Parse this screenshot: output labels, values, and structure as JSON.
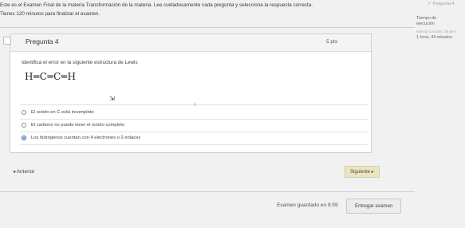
{
  "header": {
    "intro_line1": "Este es el Examen Final de la materia Transformación de la materia. Lee cuidadosamente cada pregunta y selecciona la respuesta correcta.",
    "intro_line2": "Tienes 120 minutos para finalizar el examen.",
    "nav_indicator": "Pregunta 4"
  },
  "timer": {
    "label_line1": "Tiempo de",
    "label_line2": "ejecución",
    "started": "Intento iniciado: 35 de s",
    "remaining": "1 hora, 44 minutos"
  },
  "question": {
    "title": "Pregunta 4",
    "points": "5 pts",
    "prompt": "Identifica el error en la siguiente estructura de Lewis",
    "formula": "H═C═C═H",
    "options": [
      {
        "label": "El octeto en C está incompleto",
        "selected": false
      },
      {
        "label": "El carbono no puede tener el octeto completo",
        "selected": false
      },
      {
        "label": "Los hidrógenos cuentan con 4 electrones o 2 enlaces",
        "selected": true
      }
    ]
  },
  "navigation": {
    "prev_label": "◂ Anterior",
    "next_label": "Siguiente ▸"
  },
  "footer": {
    "saved_text": "Examen guardado en 8:59",
    "submit_label": "Entregar examen"
  }
}
